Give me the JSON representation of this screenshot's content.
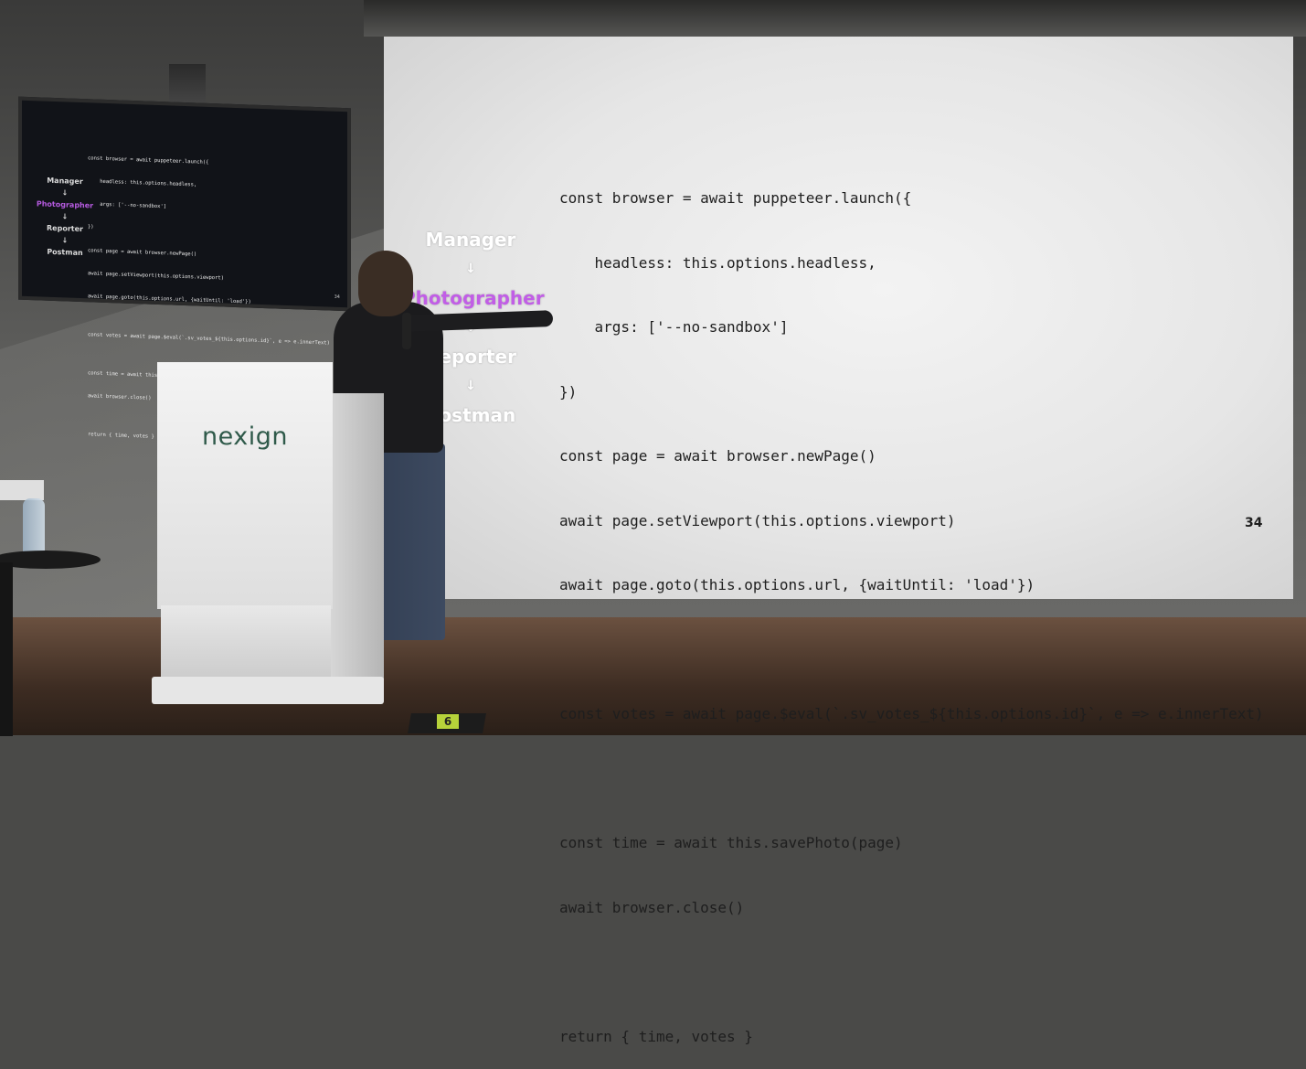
{
  "slide": {
    "nav": {
      "steps": [
        "Manager",
        "Photographer",
        "Reporter",
        "Postman"
      ],
      "active_step": "Photographer",
      "arrow_glyph": "↓"
    },
    "code_lines": [
      "const browser = await puppeteer.launch({",
      "    headless: this.options.headless,",
      "    args: ['--no-sandbox']",
      "})",
      "const page = await browser.newPage()",
      "await page.setViewport(this.options.viewport)",
      "await page.goto(this.options.url, {waitUntil: 'load'})",
      "",
      "const votes = await page.$eval(`.sv_votes_${this.options.id}`, e => e.innerText)",
      "",
      "const time = await this.savePhoto(page)",
      "await browser.close()",
      "",
      "return { time, votes }"
    ],
    "page_number": "34",
    "accent_color": "#c15ee6"
  },
  "podium": {
    "logo_text": "nexign"
  },
  "monitor": {
    "page_number": "34"
  },
  "floor_sign": {
    "label": "6"
  }
}
